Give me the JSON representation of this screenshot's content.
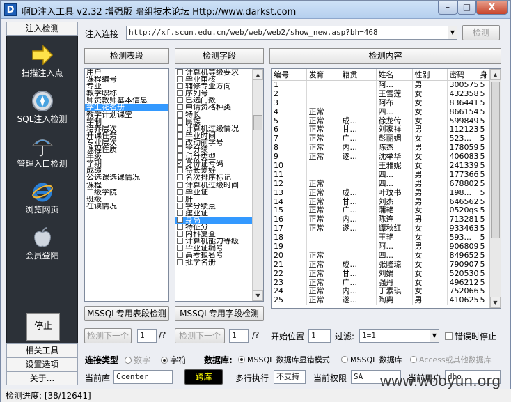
{
  "window": {
    "title": "啊D注入工具 v2.32 增强版 暗组技术论坛 Http://www.darkst.com",
    "icon_letter": "D",
    "minimize": "–",
    "maximize": "□",
    "close": "X"
  },
  "sidebar": {
    "top_tab": "注入检测",
    "items": [
      {
        "label": "扫描注入点",
        "icon": "arrow-icon"
      },
      {
        "label": "SQL注入检测",
        "icon": "compass-icon"
      },
      {
        "label": "管理入口检测",
        "icon": "umbrella-icon"
      },
      {
        "label": "浏览网页",
        "icon": "ie-icon"
      },
      {
        "label": "会员登陆",
        "icon": "apple-icon"
      }
    ],
    "stop": "停止",
    "bottom_tabs": [
      "相关工具",
      "设置选项",
      "关于..."
    ]
  },
  "inject": {
    "label": "注入连接",
    "url": "http://xf.scun.edu.cn/web/web/web2/show_new.asp?bh=468",
    "detect_button": "检测"
  },
  "tables_panel": {
    "header": "检测表段",
    "items": [
      "用户",
      "课程编号",
      "专业",
      "教学职称",
      "师资教师基本信息",
      "学生花名册",
      "教学计划课堂",
      "学制",
      "培养层次",
      "开课任务",
      "专业层次",
      "课程性质",
      "年级",
      "学期",
      "成绩",
      "公选课选课情况",
      "课程",
      "二级学院",
      "班级",
      "在读情况"
    ],
    "selected_index": 5,
    "button": "MSSQL专用表段检测"
  },
  "fields_panel": {
    "header": "检测字段",
    "items": [
      "计算机等级要求",
      "毕业审核",
      "辅修专业方向",
      "序列号",
      "已选门数",
      "申请资格种类",
      "特长",
      "民族",
      "计算机过级情况",
      "毕业时间",
      "改动前学号",
      "学分绩",
      "点分类型",
      "身份证号码",
      "特长爱好",
      "名次排序标记",
      "计算机过级时间",
      "毕业证",
      "肝",
      "学分绩点",
      "建业证",
      "身高",
      "特征分",
      "内科复查",
      "计算机能力等级",
      "毕业证编号",
      "高考报名号",
      "批学名册"
    ],
    "checked": [
      13,
      21
    ],
    "selected_index": 21,
    "button": "MSSQL专用字段检测"
  },
  "content_panel": {
    "header": "检测内容",
    "columns": [
      "编号",
      "发育",
      "籍贯",
      "姓名",
      "性别",
      "密码",
      "身"
    ],
    "rows": [
      [
        "1",
        "",
        "",
        "阿...",
        "男",
        "300575",
        "5"
      ],
      [
        "2",
        "",
        "",
        "王雪莲",
        "女",
        "432358",
        "5"
      ],
      [
        "3",
        "",
        "",
        "阿布",
        "女",
        "836441",
        "5"
      ],
      [
        "4",
        "正常",
        "",
        "四...",
        "女",
        "866154",
        "5"
      ],
      [
        "5",
        "正常",
        "成...",
        "徐龙传",
        "女",
        "599849",
        "5"
      ],
      [
        "6",
        "正常",
        "甘...",
        "刘家祥",
        "男",
        "112123",
        "5"
      ],
      [
        "7",
        "正常",
        "广...",
        "彭丽媚",
        "女",
        "523...",
        "5"
      ],
      [
        "8",
        "正常",
        "内...",
        "陈杰",
        "男",
        "178059",
        "5"
      ],
      [
        "9",
        "正常",
        "遂...",
        "沈举华",
        "女",
        "406083",
        "5"
      ],
      [
        "10",
        "",
        "",
        "王雅妮",
        "女",
        "241339",
        "5"
      ],
      [
        "11",
        "",
        "",
        "四...",
        "男",
        "177366",
        "5"
      ],
      [
        "12",
        "正常",
        "",
        "四...",
        "男",
        "678802",
        "5"
      ],
      [
        "13",
        "正常",
        "成...",
        "叶玟书",
        "男",
        "198...",
        "5"
      ],
      [
        "14",
        "正常",
        "甘...",
        "刘杰",
        "男",
        "646562",
        "5"
      ],
      [
        "15",
        "正常",
        "广...",
        "蒲艳",
        "女",
        "0520qs",
        "5"
      ],
      [
        "16",
        "正常",
        "内...",
        "陈连",
        "男",
        "713281",
        "5"
      ],
      [
        "17",
        "正常",
        "遂...",
        "谭秋红",
        "女",
        "933463",
        "5"
      ],
      [
        "18",
        "",
        "",
        "王艳",
        "女",
        "593...",
        "5"
      ],
      [
        "19",
        "",
        "",
        "阿...",
        "男",
        "906809",
        "5"
      ],
      [
        "20",
        "正常",
        "",
        "四...",
        "女",
        "849652",
        "5"
      ],
      [
        "21",
        "正常",
        "成...",
        "张隆琼",
        "女",
        "790907",
        "5"
      ],
      [
        "22",
        "正常",
        "甘...",
        "刘娟",
        "女",
        "520530",
        "5"
      ],
      [
        "23",
        "正常",
        "广...",
        "强丹",
        "女",
        "496212",
        "5"
      ],
      [
        "24",
        "正常",
        "内...",
        "丁素琪",
        "女",
        "752066",
        "5"
      ],
      [
        "25",
        "正常",
        "遂...",
        "陶离",
        "男",
        "410625",
        "5"
      ]
    ]
  },
  "pager": {
    "tables_next": "检测下一个",
    "tables_page": "1",
    "tables_total": "/?",
    "fields_next": "检测下一个",
    "fields_page": "1",
    "fields_total": "/?",
    "start_label": "开始位置",
    "start_value": "1",
    "filter_label": "过滤:",
    "filter_value": "1=1",
    "stop_on_error": "错误时停止"
  },
  "options": {
    "conn_label": "连接类型",
    "conn_number": "数字",
    "conn_string": "字符",
    "db_label": "数据库:",
    "db_mssql_err": "MSSQL 数据库显错模式",
    "db_mssql": "MSSQL 数据库",
    "db_access": "Access或其他数据库",
    "current_db_label": "当前库",
    "current_db_value": "Ccenter",
    "cross_db": "跨库",
    "multi_label": "多行执行",
    "multi_value": "不支持",
    "perm_label": "当前权限",
    "perm_value": "SA",
    "user_label": "当前用户",
    "user_value": "dbo"
  },
  "status": {
    "text": "检测进度: [38/12641]"
  },
  "watermark": "www.wooyun.org",
  "colors": {
    "sidebar_bg": "#2c3138",
    "selection": "#3399ff",
    "cross_db_bg": "#000000",
    "cross_db_fg": "#ffff00"
  }
}
